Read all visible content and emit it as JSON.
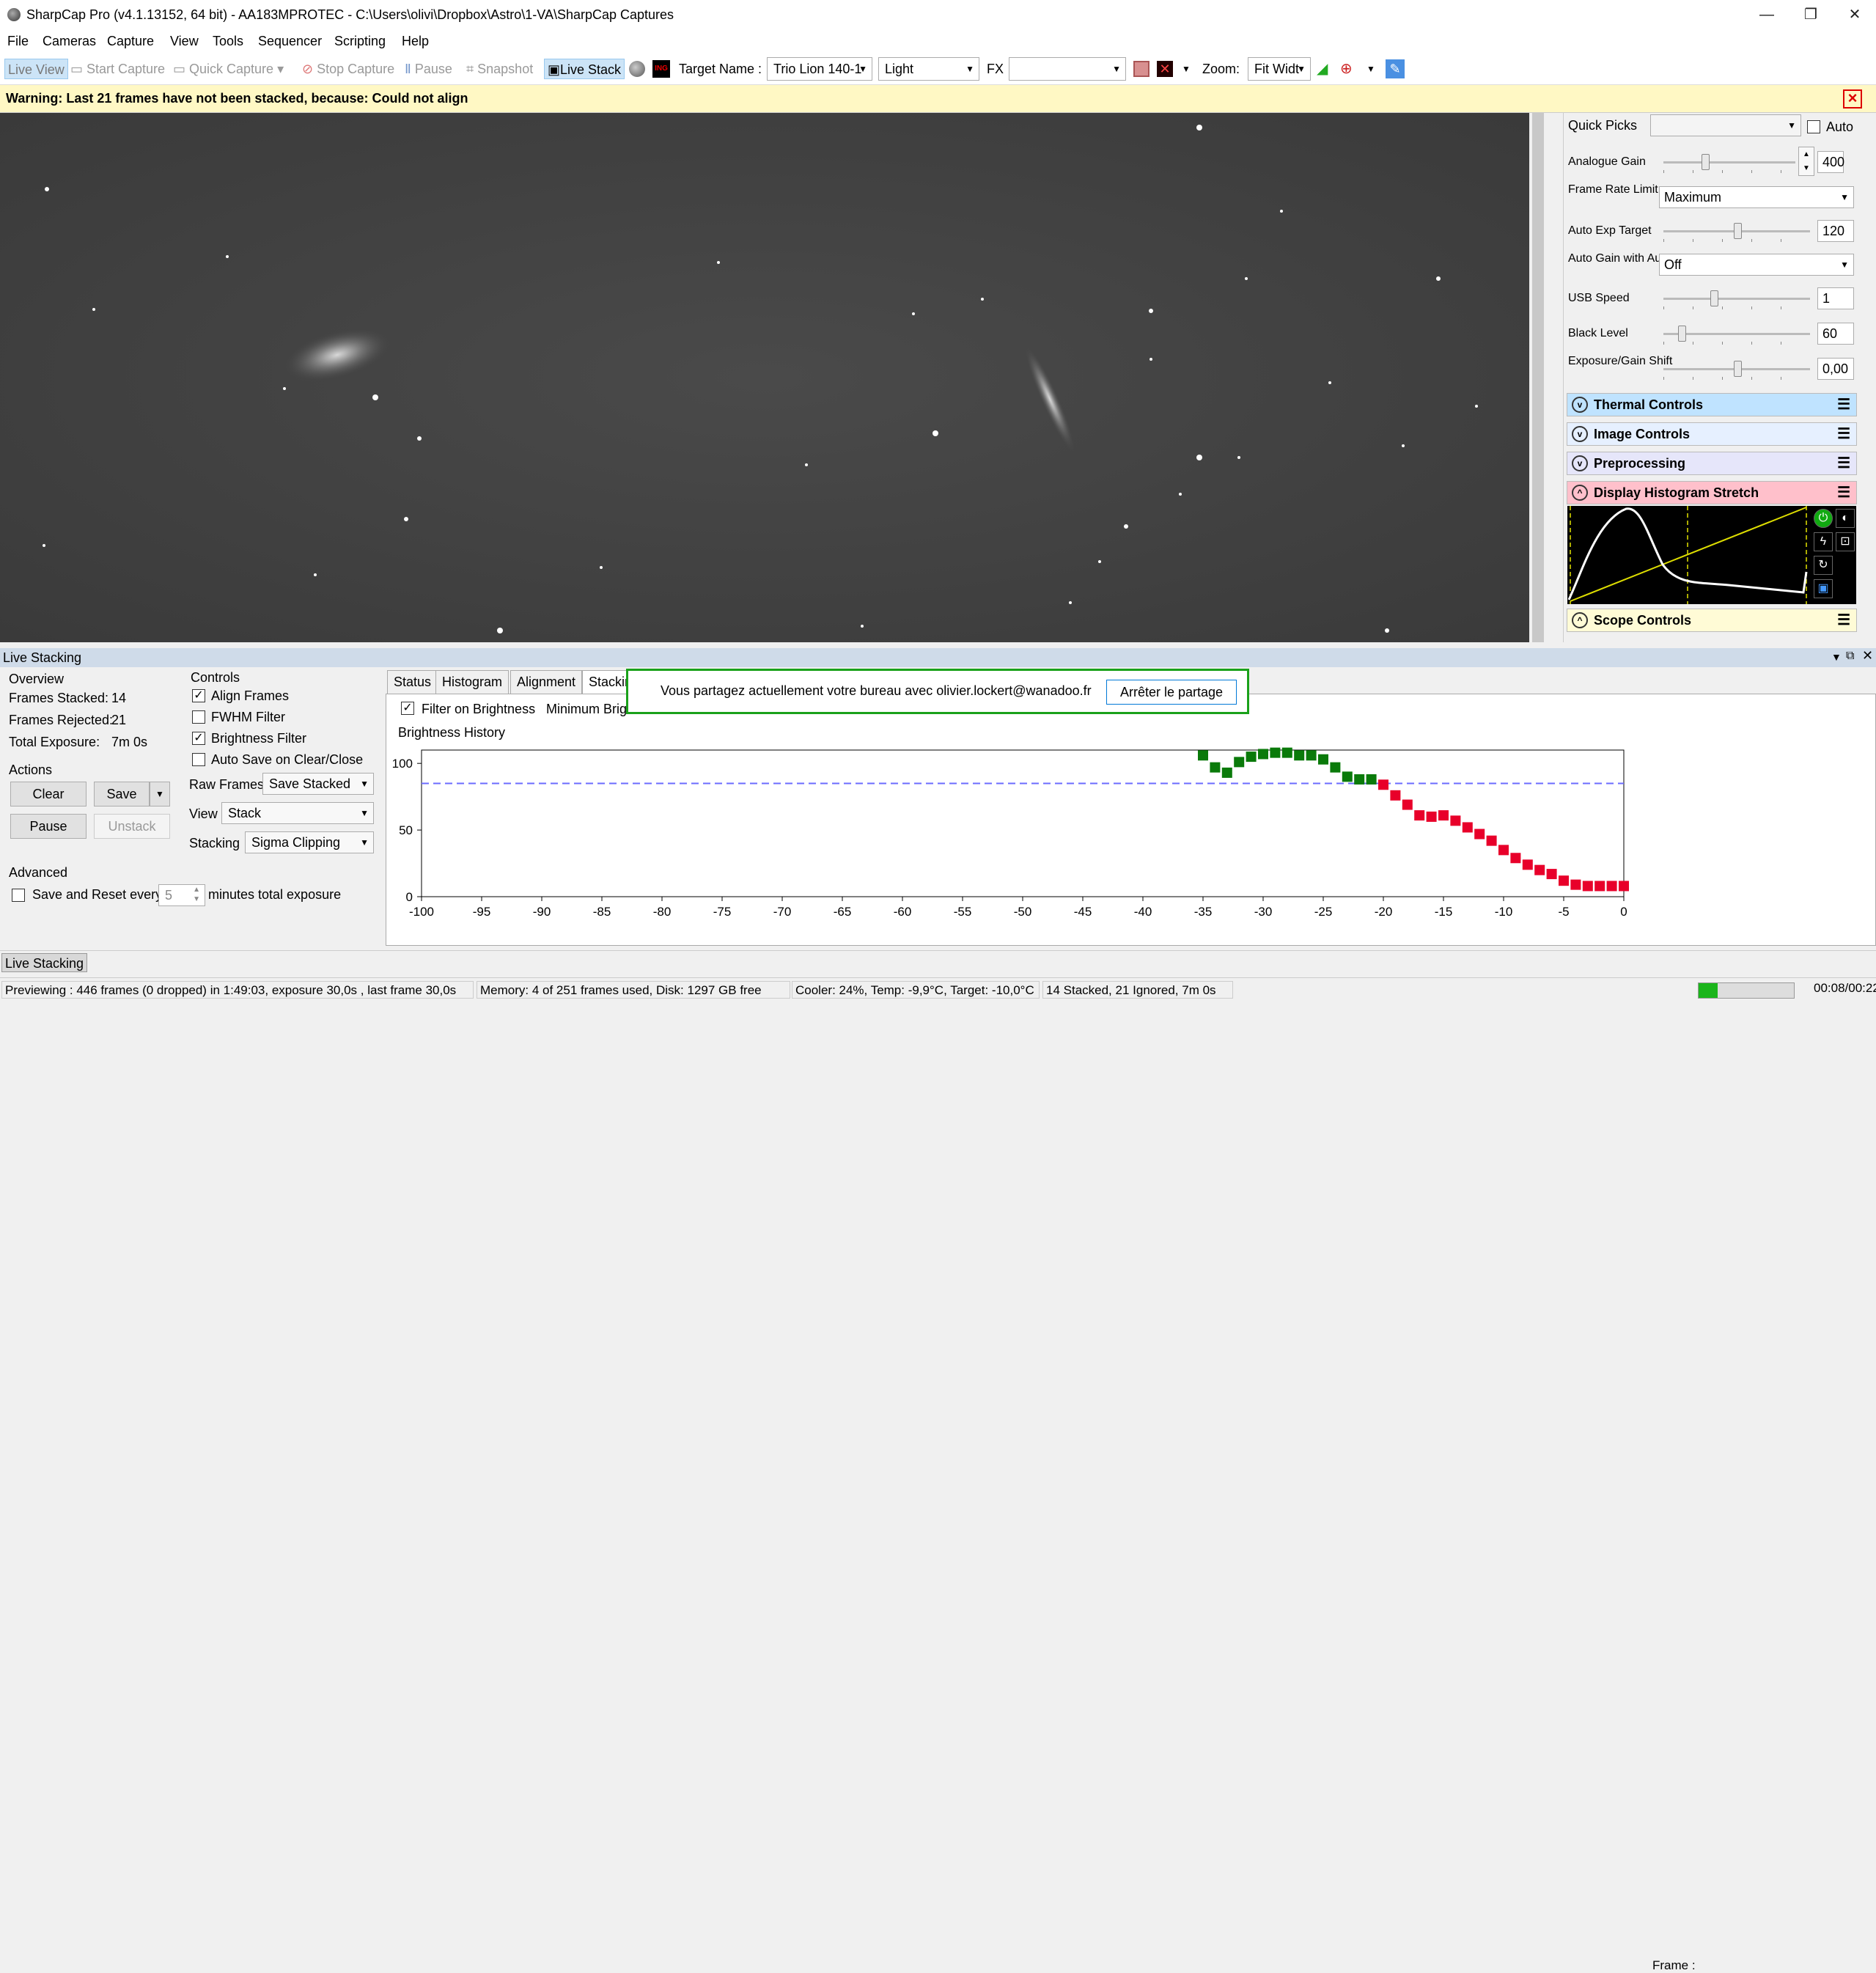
{
  "window": {
    "title": "SharpCap Pro (v4.1.13152, 64 bit) - AA183MPROTEC - C:\\Users\\olivi\\Dropbox\\Astro\\1-VA\\SharpCap Captures",
    "minimize": "—",
    "restore": "❐",
    "close": "✕"
  },
  "menu": [
    "File",
    "Cameras",
    "Capture",
    "View",
    "Tools",
    "Sequencer",
    "Scripting",
    "Help"
  ],
  "toolbar": {
    "live_view": "Live View",
    "start_capture": "Start Capture",
    "quick_capture": "Quick Capture",
    "stop_capture": "Stop Capture",
    "pause": "Pause",
    "snapshot": "Snapshot",
    "live_stack": "Live Stack",
    "target_label": "Target Name :",
    "target_value": "Trio Lion 140-1",
    "frame_type": "Light",
    "fx_label": "FX",
    "fx_value": "",
    "zoom_label": "Zoom:",
    "zoom_value": "Fit Widt"
  },
  "warning": "Warning: Last 21 frames have not been stacked, because: Could not align",
  "side": {
    "quick_picks_label": "Quick Picks",
    "auto_label": "Auto",
    "analogue_gain_label": "Analogue Gain",
    "analogue_gain": "400",
    "frame_rate_label": "Frame Rate Limit",
    "frame_rate": "Maximum",
    "auto_exp_label": "Auto Exp Target",
    "auto_exp": "120",
    "auto_gain_label": "Auto Gain with Auto Exposure",
    "auto_gain": "Off",
    "usb_label": "USB Speed",
    "usb": "1",
    "black_label": "Black Level",
    "black": "60",
    "shift_label": "Exposure/Gain Shift",
    "shift": "0,00",
    "sections": [
      "Thermal Controls",
      "Image Controls",
      "Preprocessing",
      "Display Histogram Stretch",
      "Scope Controls"
    ],
    "section_colors": [
      "#bfe3ff",
      "#e6f0ff",
      "#e6e6fa",
      "#ffc0cb",
      "#fffbd6"
    ]
  },
  "panel": {
    "title": "Live Stacking",
    "overview_title": "Overview",
    "frames_stacked_label": "Frames Stacked:",
    "frames_stacked": "14",
    "frames_rejected_label": "Frames Rejected:",
    "frames_rejected": "21",
    "total_exposure_label": "Total Exposure:",
    "total_exposure": "7m 0s",
    "actions_title": "Actions",
    "clear": "Clear",
    "save": "Save",
    "pause": "Pause",
    "unstack": "Unstack",
    "advanced_title": "Advanced",
    "save_reset_label": "Save and Reset every",
    "save_reset_value": "5",
    "minutes_label": "minutes total exposure",
    "controls_title": "Controls",
    "align_frames": "Align Frames",
    "fwhm_filter": "FWHM Filter",
    "brightness_filter": "Brightness Filter",
    "auto_save": "Auto Save on Clear/Close",
    "raw_frames_label": "Raw Frames",
    "raw_frames": "Save Stacked",
    "view_label": "View",
    "view": "Stack",
    "stacking_label": "Stacking",
    "stacking": "Sigma Clipping",
    "tabs": [
      "Status",
      "Histogram",
      "Alignment",
      "Stacking"
    ],
    "filter_brightness": "Filter on Brightness",
    "min_brightness": "Minimum Brig",
    "brightness_history": "Brightness History"
  },
  "share": {
    "text": "Vous partagez actuellement votre bureau avec olivier.lockert@wanadoo.fr",
    "button": "Arrêter le partage"
  },
  "chart_data": {
    "type": "scatter",
    "title": "Brightness History",
    "xlim": [
      -100,
      0
    ],
    "ylim": [
      0,
      110
    ],
    "xticks": [
      -100,
      -95,
      -90,
      -85,
      -80,
      -75,
      -70,
      -65,
      -60,
      -55,
      -50,
      -45,
      -40,
      -35,
      -30,
      -25,
      -20,
      -15,
      -10,
      -5,
      0
    ],
    "yticks": [
      0,
      50,
      100
    ],
    "threshold": 85,
    "series": [
      {
        "color": "#0a7a0a",
        "x": [
          -35,
          -34,
          -33,
          -32,
          -31,
          -30,
          -29,
          -28,
          -27,
          -26,
          -25,
          -24,
          -23,
          -22,
          -21
        ],
        "y": [
          106,
          97,
          93,
          101,
          105,
          107,
          108,
          108,
          106,
          106,
          103,
          97,
          90,
          88,
          88
        ]
      },
      {
        "color": "#e8002a",
        "x": [
          -20,
          -19,
          -18,
          -17,
          -16,
          -15,
          -14,
          -13,
          -12,
          -11,
          -10,
          -9,
          -8,
          -7,
          -6,
          -5,
          -4,
          -3,
          -2,
          -1,
          0
        ],
        "y": [
          84,
          76,
          69,
          61,
          60,
          61,
          57,
          52,
          47,
          42,
          35,
          29,
          24,
          20,
          17,
          12,
          9,
          8,
          8,
          8,
          8
        ]
      }
    ]
  },
  "statusbar": {
    "preview": "Previewing : 446 frames (0 dropped) in 1:49:03, exposure 30,0s , last frame 30,0s",
    "memory": "Memory: 4 of 251 frames used, Disk: 1297 GB free",
    "cooler": "Cooler: 24%, Temp: -9,9°C, Target: -10,0°C",
    "stacked": "14 Stacked, 21 Ignored, 7m 0s",
    "frame_label": "Frame :",
    "frame_progress": 0.2,
    "time": "00:08/00:22"
  },
  "bottom_tab": "Live Stacking"
}
